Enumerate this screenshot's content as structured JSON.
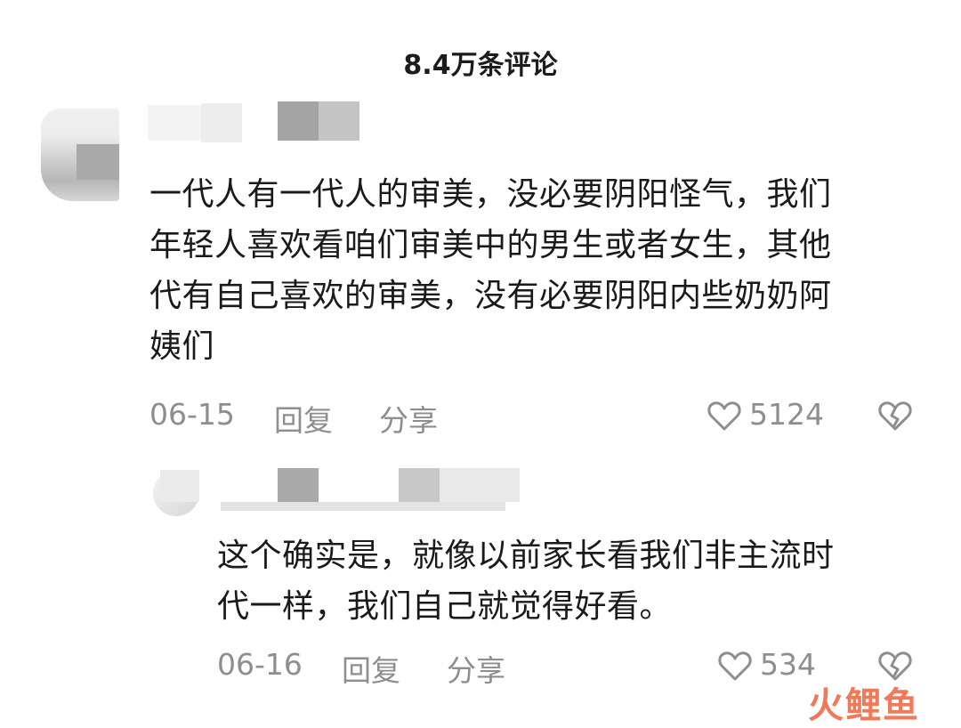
{
  "header": {
    "title": "8.4万条评论"
  },
  "comments": [
    {
      "text_lines": [
        "一代人有一代人的审美，没必要阴阳怪气，我们",
        "年轻人喜欢看咱们审美中的男生或者女生，其他",
        "代有自己喜欢的审美，没有必要阴阳内些奶奶阿",
        "姨们"
      ],
      "date": "06-15",
      "reply_label": "回复",
      "share_label": "分享",
      "likes": "5124"
    },
    {
      "text_lines": [
        "这个确实是，就像以前家长看我们非主流时",
        "代一样，我们自己就觉得好看。"
      ],
      "date": "06-16",
      "reply_label": "回复",
      "share_label": "分享",
      "likes": "534"
    }
  ],
  "watermark": {
    "text": "火鲤鱼"
  },
  "icons": {
    "like": "heart-outline-icon",
    "dislike": "broken-heart-icon"
  },
  "colors": {
    "text": "#1a1a1a",
    "meta": "#8e8e8e",
    "watermark": "#f06b45"
  }
}
